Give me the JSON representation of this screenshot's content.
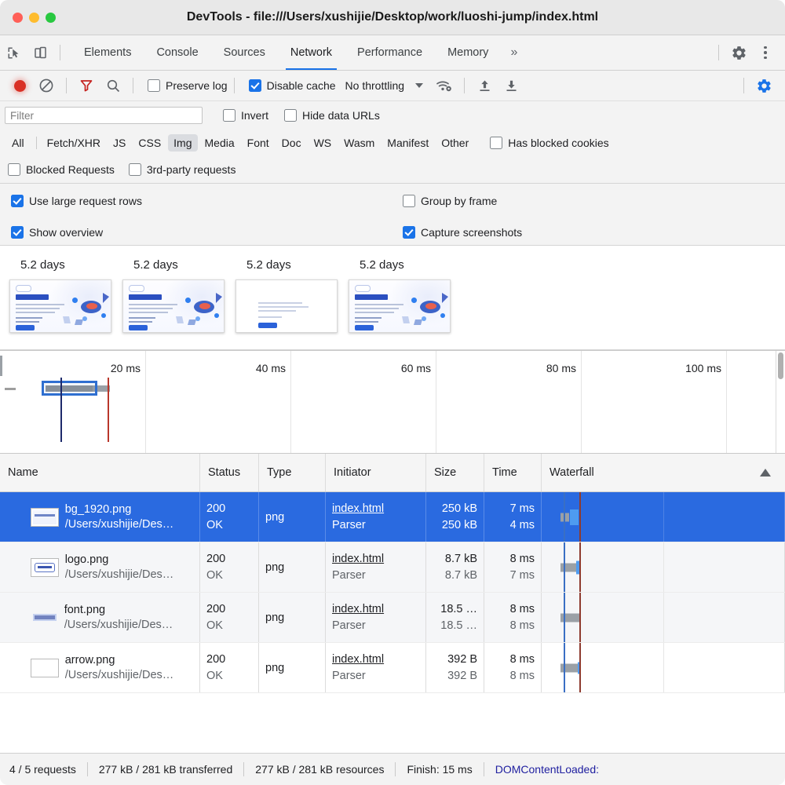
{
  "window": {
    "title": "DevTools - file:///Users/xushijie/Desktop/work/luoshi-jump/index.html",
    "traffic_lights": [
      "close",
      "minimize",
      "zoom"
    ]
  },
  "tabbar": {
    "icons": [
      "inspect-element-icon",
      "device-toolbar-icon"
    ],
    "tabs": [
      {
        "label": "Elements",
        "active": false
      },
      {
        "label": "Console",
        "active": false
      },
      {
        "label": "Sources",
        "active": false
      },
      {
        "label": "Network",
        "active": true
      },
      {
        "label": "Performance",
        "active": false
      },
      {
        "label": "Memory",
        "active": false
      }
    ],
    "more_label": "»",
    "right_icons": [
      "settings-gear-icon",
      "more-options-icon"
    ]
  },
  "network_toolbar": {
    "record_tooltip": "record",
    "clear_tooltip": "clear",
    "filter_tooltip": "filter",
    "search_tooltip": "search",
    "preserve_log": {
      "label": "Preserve log",
      "checked": false
    },
    "disable_cache": {
      "label": "Disable cache",
      "checked": true
    },
    "throttling": {
      "value": "No throttling"
    },
    "right_icons": [
      "wifi-settings-icon",
      "upload-icon",
      "download-icon",
      "settings-gear-icon"
    ]
  },
  "filter": {
    "placeholder": "Filter",
    "value": "",
    "invert": {
      "label": "Invert",
      "checked": false
    },
    "hide_data_urls": {
      "label": "Hide data URLs",
      "checked": false
    }
  },
  "type_filters": {
    "all_label": "All",
    "types": [
      "Fetch/XHR",
      "JS",
      "CSS",
      "Img",
      "Media",
      "Font",
      "Doc",
      "WS",
      "Wasm",
      "Manifest",
      "Other"
    ],
    "selected": "Img",
    "has_blocked_cookies": {
      "label": "Has blocked cookies",
      "checked": false
    },
    "blocked_requests": {
      "label": "Blocked Requests",
      "checked": false
    },
    "third_party_requests": {
      "label": "3rd-party requests",
      "checked": false
    }
  },
  "settings_pane": {
    "use_large_request_rows": {
      "label": "Use large request rows",
      "checked": true
    },
    "group_by_frame": {
      "label": "Group by frame",
      "checked": false
    },
    "show_overview": {
      "label": "Show overview",
      "checked": true
    },
    "capture_screenshots": {
      "label": "Capture screenshots",
      "checked": true
    }
  },
  "filmstrip": {
    "frames": [
      {
        "time": "5.2 days",
        "blank": false
      },
      {
        "time": "5.2 days",
        "blank": false
      },
      {
        "time": "5.2 days",
        "blank": true
      },
      {
        "time": "5.2 days",
        "blank": false
      }
    ]
  },
  "overview": {
    "ticks": [
      "20 ms",
      "40 ms",
      "60 ms",
      "80 ms",
      "100 ms"
    ],
    "selection_present": true,
    "dcl_marker_color": "#1d2a6b",
    "load_marker_color": "#b9372b"
  },
  "table": {
    "columns": [
      "Name",
      "Status",
      "Type",
      "Initiator",
      "Size",
      "Time",
      "Waterfall"
    ],
    "sort_indicator": "ascending",
    "rows": [
      {
        "name": "bg_1920.png",
        "path": "/Users/xushijie/Des…",
        "status_code": "200",
        "status_text": "OK",
        "type": "png",
        "initiator": "index.html",
        "initiator_detail": "Parser",
        "size": "250 kB",
        "size_detail": "250 kB",
        "time": "7 ms",
        "time_detail": "4 ms",
        "selected": true,
        "icon": "image-thumbnail-icon"
      },
      {
        "name": "logo.png",
        "path": "/Users/xushijie/Des…",
        "status_code": "200",
        "status_text": "OK",
        "type": "png",
        "initiator": "index.html",
        "initiator_detail": "Parser",
        "size": "8.7 kB",
        "size_detail": "8.7 kB",
        "time": "8 ms",
        "time_detail": "7 ms",
        "selected": false,
        "icon": "logo-thumbnail-icon"
      },
      {
        "name": "font.png",
        "path": "/Users/xushijie/Des…",
        "status_code": "200",
        "status_text": "OK",
        "type": "png",
        "initiator": "index.html",
        "initiator_detail": "Parser",
        "size": "18.5 …",
        "size_detail": "18.5 …",
        "time": "8 ms",
        "time_detail": "8 ms",
        "selected": false,
        "icon": "font-thumbnail-icon"
      },
      {
        "name": "arrow.png",
        "path": "/Users/xushijie/Des…",
        "status_code": "200",
        "status_text": "OK",
        "type": "png",
        "initiator": "index.html",
        "initiator_detail": "Parser",
        "size": "392 B",
        "size_detail": "392 B",
        "time": "8 ms",
        "time_detail": "8 ms",
        "selected": false,
        "icon": "blank-thumbnail-icon"
      }
    ]
  },
  "statusbar": {
    "requests": "4 / 5 requests",
    "transferred": "277 kB / 281 kB transferred",
    "resources": "277 kB / 281 kB resources",
    "finish": "Finish: 15 ms",
    "dom_content_loaded": "DOMContentLoaded:"
  },
  "colors": {
    "accent": "#1a73e8",
    "selection": "#2a6ae0",
    "record_red": "#d93025",
    "dcl_blue": "#2020a0"
  }
}
